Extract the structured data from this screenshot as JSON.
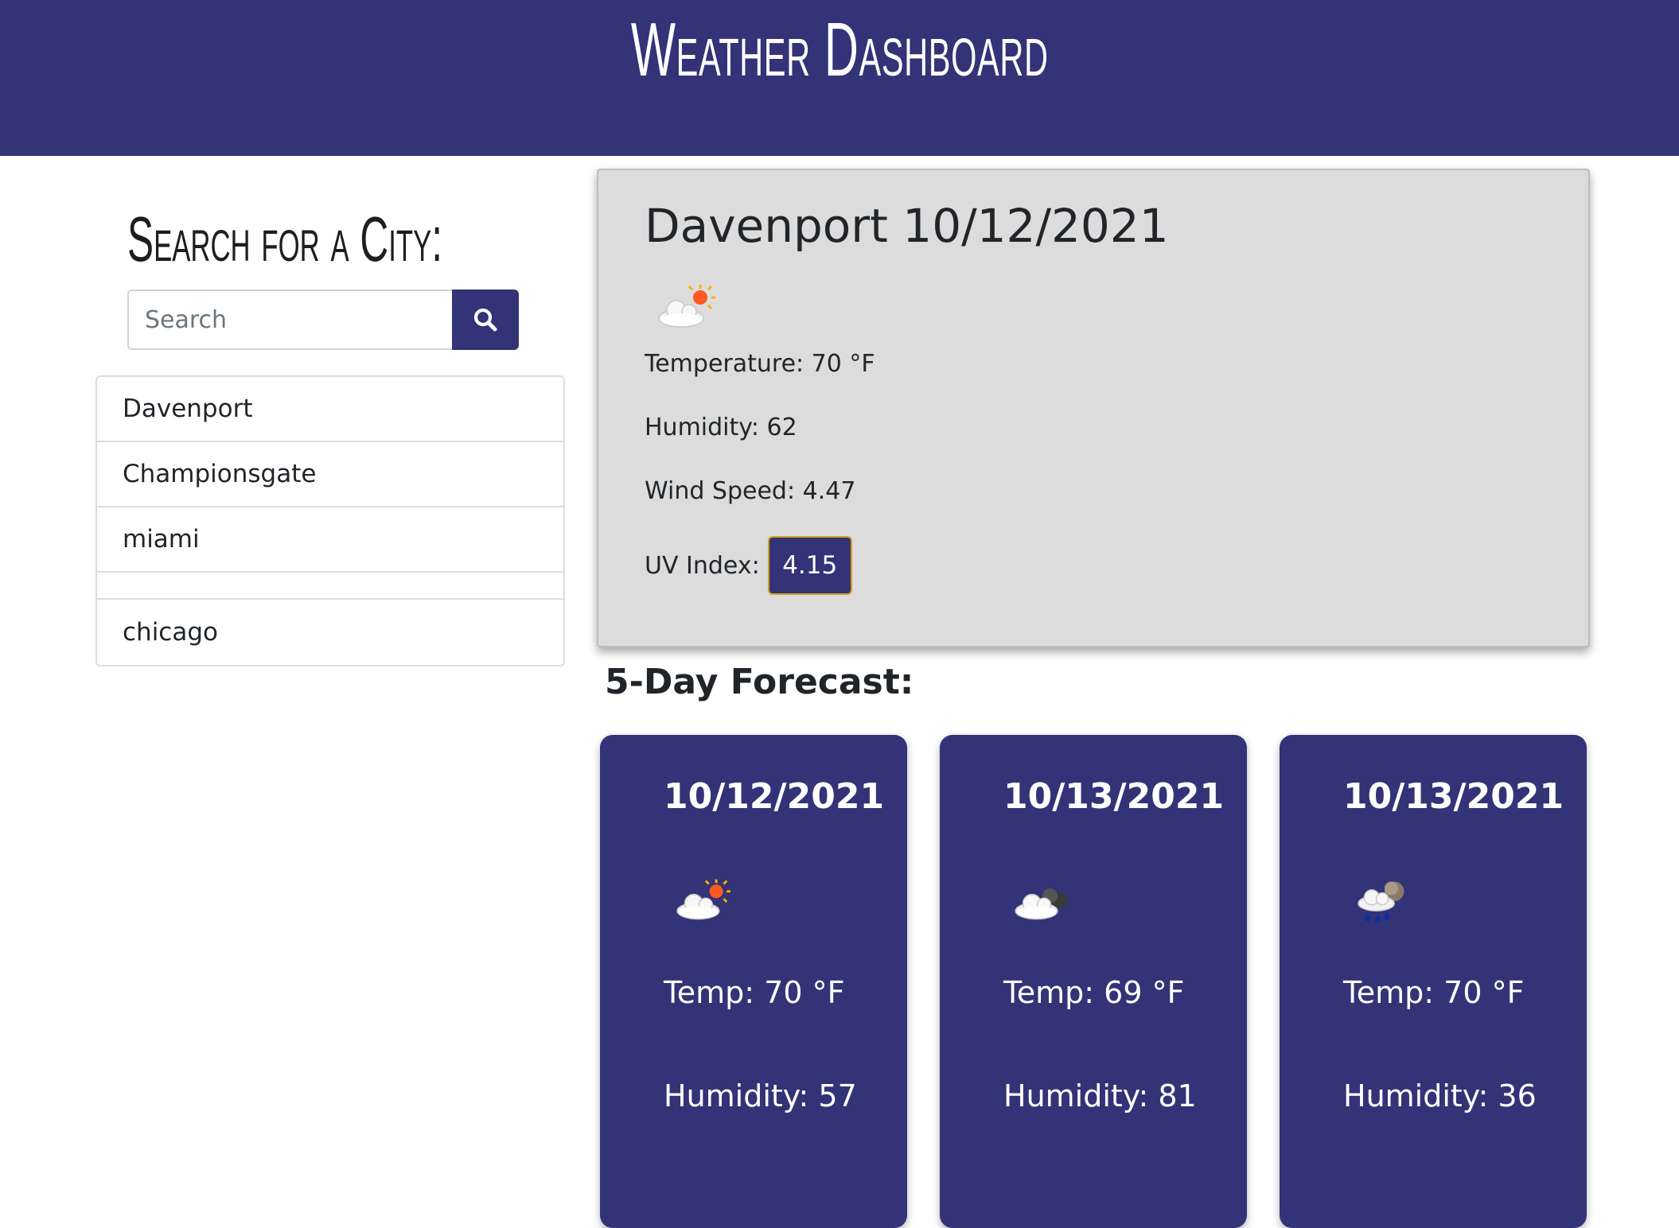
{
  "header": {
    "title": "Weather Dashboard"
  },
  "sidebar": {
    "heading": "Search for a City:",
    "search": {
      "placeholder": "Search",
      "value": ""
    },
    "search_button_icon": "search-icon",
    "cities": [
      "Davenport",
      "Championsgate",
      "miami",
      "",
      "chicago"
    ]
  },
  "current": {
    "title": "Davenport 10/12/2021",
    "icon": "partly-cloudy-day-icon",
    "temperature": "Temperature: 70 °F",
    "humidity": "Humidity: 62",
    "wind": "Wind Speed: 4.47",
    "uv_label": "UV Index:",
    "uv_value": "4.15"
  },
  "forecast": {
    "heading": "5-Day Forecast:",
    "days": [
      {
        "date": "10/12/2021",
        "icon": "partly-cloudy-day-icon",
        "temp": "Temp: 70 °F",
        "humidity": "Humidity: 57"
      },
      {
        "date": "10/13/2021",
        "icon": "partly-cloudy-night-icon",
        "temp": "Temp: 69 °F",
        "humidity": "Humidity: 81"
      },
      {
        "date": "10/13/2021",
        "icon": "rain-night-icon",
        "temp": "Temp: 70 °F",
        "humidity": "Humidity: 36"
      }
    ]
  },
  "colors": {
    "brand": "#333377",
    "card_bg": "#dcdcdc",
    "uv_border": "#d4a017"
  }
}
